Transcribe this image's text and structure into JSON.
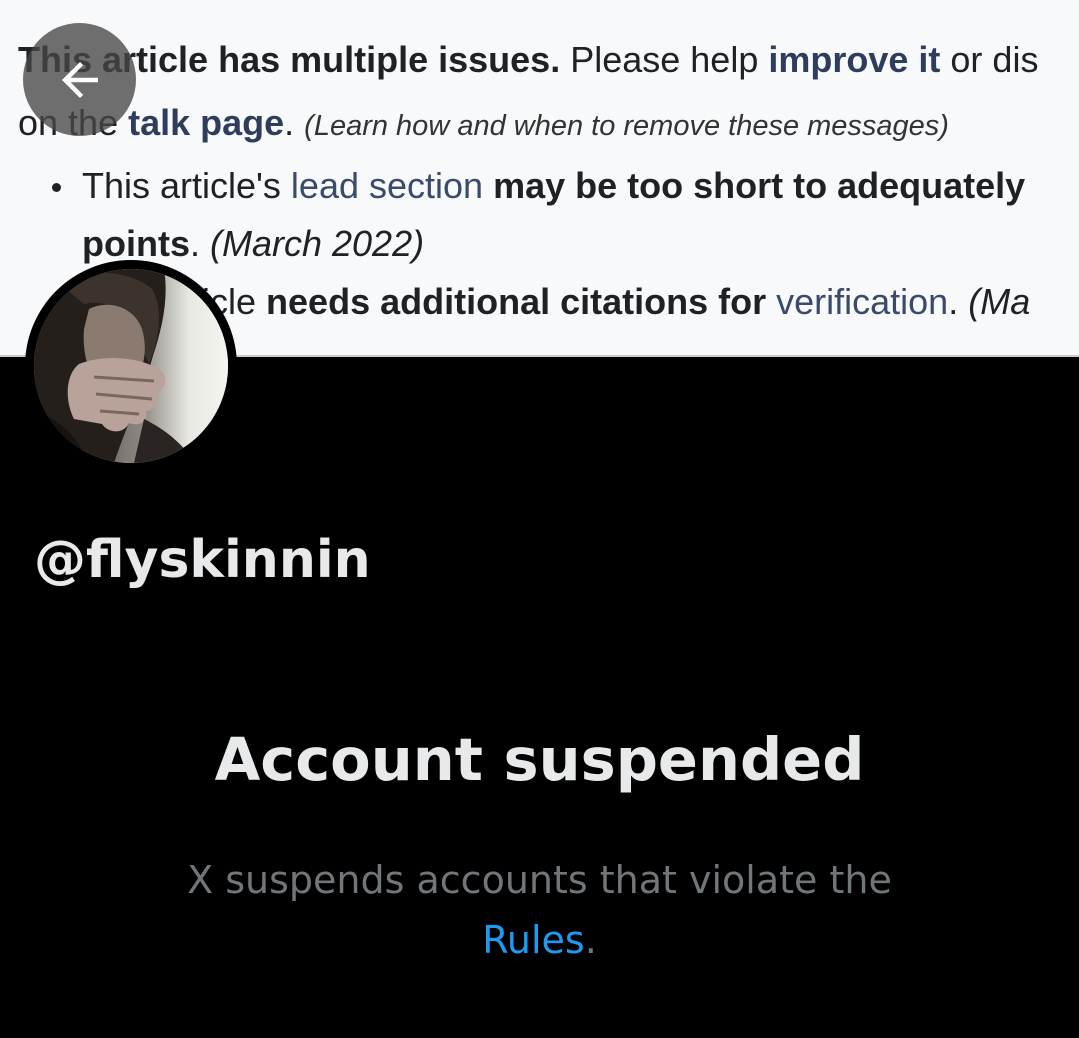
{
  "banner": {
    "line1": {
      "bold": "This article has multiple issues.",
      "text1": " Please help ",
      "link": "improve it",
      "text2": " or dis"
    },
    "line2": {
      "text1": "on the ",
      "link": "talk page",
      "text2": ". ",
      "note": "(Learn how and when to remove these messages)"
    },
    "item1": {
      "text1": "This article's ",
      "link": "lead section",
      "text2": " ",
      "bold": "may be too short to adequately",
      "cont_bold": "points",
      "cont_text": ". ",
      "date": "(March 2022)"
    },
    "item2": {
      "text1": "This article ",
      "bold": "needs additional citations for ",
      "link": "verification",
      "text2": ". ",
      "date": "(Ma"
    }
  },
  "back_button": {
    "icon": "arrow-left-icon"
  },
  "profile": {
    "handle": "@flyskinnin"
  },
  "notice": {
    "title": "Account suspended",
    "text": "X suspends accounts that violate the",
    "link": "Rules",
    "period": "."
  },
  "colors": {
    "background": "#000000",
    "primary_text": "#e7e9ea",
    "secondary_text": "#71767b",
    "link": "#1d9bf0"
  }
}
